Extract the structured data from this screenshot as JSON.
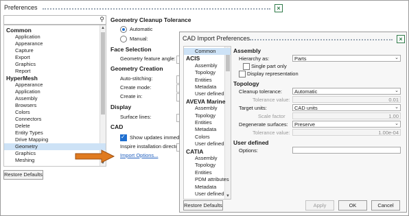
{
  "preferences": {
    "title": "Preferences",
    "search": {
      "value": "",
      "icon": "search-icon"
    },
    "tree": [
      {
        "type": "header",
        "label": "Common"
      },
      {
        "type": "item",
        "label": "Application"
      },
      {
        "type": "item",
        "label": "Appearance"
      },
      {
        "type": "item",
        "label": "Capture"
      },
      {
        "type": "item",
        "label": "Export"
      },
      {
        "type": "item",
        "label": "Graphics"
      },
      {
        "type": "item",
        "label": "Report"
      },
      {
        "type": "header",
        "label": "HyperMesh"
      },
      {
        "type": "item",
        "label": "Appearance"
      },
      {
        "type": "item",
        "label": "Application"
      },
      {
        "type": "item",
        "label": "Assembly"
      },
      {
        "type": "item",
        "label": "Browsers"
      },
      {
        "type": "item",
        "label": "Colors"
      },
      {
        "type": "item",
        "label": "Connectors"
      },
      {
        "type": "item",
        "label": "Delete"
      },
      {
        "type": "item",
        "label": "Entity Types"
      },
      {
        "type": "item",
        "label": "Drive Mapping"
      },
      {
        "type": "item",
        "label": "Geometry",
        "selected": true
      },
      {
        "type": "item",
        "label": "Graphics"
      },
      {
        "type": "item",
        "label": "Meshing"
      }
    ],
    "restore_label": "Restore Defaults",
    "settings": {
      "geometry_cleanup_tolerance": "Geometry Cleanup Tolerance",
      "automatic": "Automatic",
      "manual": "Manual:",
      "face_selection": "Face Selection",
      "geometry_feature_angle": "Geometry feature angle:",
      "geometry_creation": "Geometry Creation",
      "auto_stitching": "Auto-stitching:",
      "create_mode": "Create mode:",
      "create_in": "Create in:",
      "display": "Display",
      "surface_lines": "Surface lines:",
      "cad": "CAD",
      "show_updates": "Show updates immediately",
      "inspire_dir": "Inspire installation directory",
      "import_options": "Import Options..."
    }
  },
  "cad_import": {
    "title": "CAD Import Preferences",
    "tree": [
      {
        "type": "item",
        "label": "Common",
        "selected": true
      },
      {
        "type": "header",
        "label": "ACIS"
      },
      {
        "type": "item",
        "label": "Assembly"
      },
      {
        "type": "item",
        "label": "Topology"
      },
      {
        "type": "item",
        "label": "Entities"
      },
      {
        "type": "item",
        "label": "Metadata"
      },
      {
        "type": "item",
        "label": "User defined"
      },
      {
        "type": "header",
        "label": "AVEVA Marine"
      },
      {
        "type": "item",
        "label": "Assembly"
      },
      {
        "type": "item",
        "label": "Topology"
      },
      {
        "type": "item",
        "label": "Entities"
      },
      {
        "type": "item",
        "label": "Metadata"
      },
      {
        "type": "item",
        "label": "Colors"
      },
      {
        "type": "item",
        "label": "User defined"
      },
      {
        "type": "header",
        "label": "CATIA"
      },
      {
        "type": "item",
        "label": "Assembly"
      },
      {
        "type": "item",
        "label": "Topology"
      },
      {
        "type": "item",
        "label": "Entities"
      },
      {
        "type": "item",
        "label": "PDM attributes"
      },
      {
        "type": "item",
        "label": "Metadata"
      },
      {
        "type": "item",
        "label": "User defined"
      }
    ],
    "assembly": {
      "title": "Assembly",
      "hierarchy_label": "Hierarchy as:",
      "hierarchy_value": "Parts",
      "single_part_only": "Single part only",
      "display_representation": "Display representation"
    },
    "topology": {
      "title": "Topology",
      "cleanup_tolerance_label": "Cleanup tolerance:",
      "cleanup_tolerance_value": "Automatic",
      "tolerance_value_label": "Tolerance value:",
      "tolerance_value": "0.01",
      "target_units_label": "Target units:",
      "target_units_value": "CAD units",
      "scale_factor_label": "Scale factor",
      "scale_factor_value": "1.00",
      "degenerate_label": "Degenerate surfaces:",
      "degenerate_value": "Preserve",
      "degenerate_tol_label": "Tolerance value:",
      "degenerate_tol_value": "1.00e-04"
    },
    "user_defined": {
      "title": "User defined",
      "options_label": "Options:",
      "options_value": ""
    },
    "buttons": {
      "restore": "Restore Defaults",
      "apply": "Apply",
      "ok": "OK",
      "cancel": "Cancel"
    }
  },
  "colors": {
    "accent": "#1f6fd0",
    "arrow": "#e07a1f",
    "selection": "#cde2f6",
    "close": "#2f7a49"
  }
}
